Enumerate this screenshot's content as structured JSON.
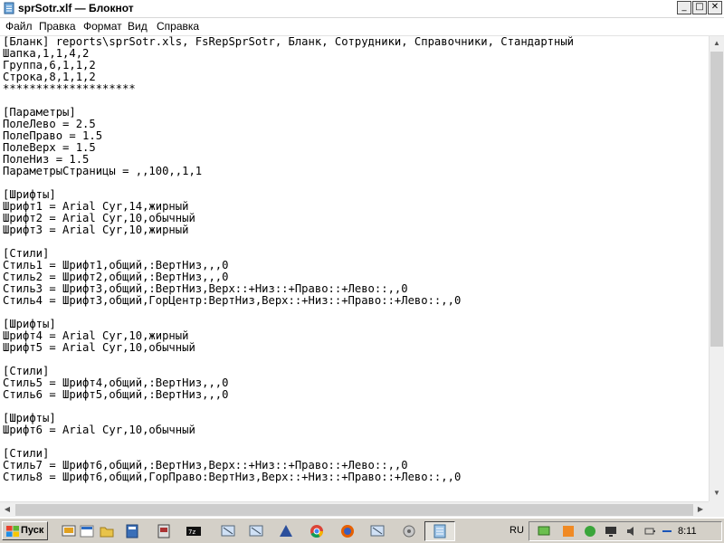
{
  "window": {
    "title": "sprSotr.xlf — Блокнот",
    "buttons": {
      "minimize": "_",
      "maximize": "□",
      "close": "✕"
    }
  },
  "menu": [
    "Файл",
    "Правка",
    "Формат",
    "Вид",
    "Справка"
  ],
  "editor": {
    "content": "[Бланк] reports\\sprSotr.xls, FsRepSprSotr, Бланк, Сотрудники, Справочники, Стандартный\nШапка,1,1,4,2\nГруппа,6,1,1,2\nСтрока,8,1,1,2\n********************\n\n[Параметры]\nПолеЛево = 2.5\nПолеПраво = 1.5\nПолеВерх = 1.5\nПолеНиз = 1.5\nПараметрыСтраницы = ,,100,,1,1\n\n[Шрифты]\nШрифт1 = Arial Cyr,14,жирный\nШрифт2 = Arial Cyr,10,обычный\nШрифт3 = Arial Cyr,10,жирный\n\n[Стили]\nСтиль1 = Шрифт1,общий,:ВертНиз,,,0\nСтиль2 = Шрифт2,общий,:ВертНиз,,,0\nСтиль3 = Шрифт3,общий,:ВертНиз,Верх::+Низ::+Право::+Лево::,,0\nСтиль4 = Шрифт3,общий,ГорЦентр:ВертНиз,Верх::+Низ::+Право::+Лево::,,0\n\n[Шрифты]\nШрифт4 = Arial Cyr,10,жирный\nШрифт5 = Arial Cyr,10,обычный\n\n[Стили]\nСтиль5 = Шрифт4,общий,:ВертНиз,,,0\nСтиль6 = Шрифт5,общий,:ВертНиз,,,0\n\n[Шрифты]\nШрифт6 = Arial Cyr,10,обычный\n\n[Стили]\nСтиль7 = Шрифт6,общий,:ВертНиз,Верх::+Низ::+Право::+Лево::,,0\nСтиль8 = Шрифт6,общий,ГорПраво:ВертНиз,Верх::+Низ::+Право::+Лево::,,0"
  },
  "taskbar": {
    "start_label": "Пуск",
    "quick_launch_icons": [
      "show-desktop-icon",
      "explorer-icon",
      "folder-icon",
      "calculator-icon",
      "document-icon",
      "7zip-icon",
      "network-icon",
      "network-icon",
      "triangle-app-icon",
      "chrome-icon",
      "firefox-icon",
      "network-icon",
      "tools-icon"
    ],
    "active_task_icon": "notepad-icon",
    "language": "RU",
    "clock": "8:11"
  },
  "colors": {
    "taskbar": "#d4d0c8",
    "scrollbar_thumb": "#cdcdcd",
    "window_bg": "#ffffff"
  }
}
